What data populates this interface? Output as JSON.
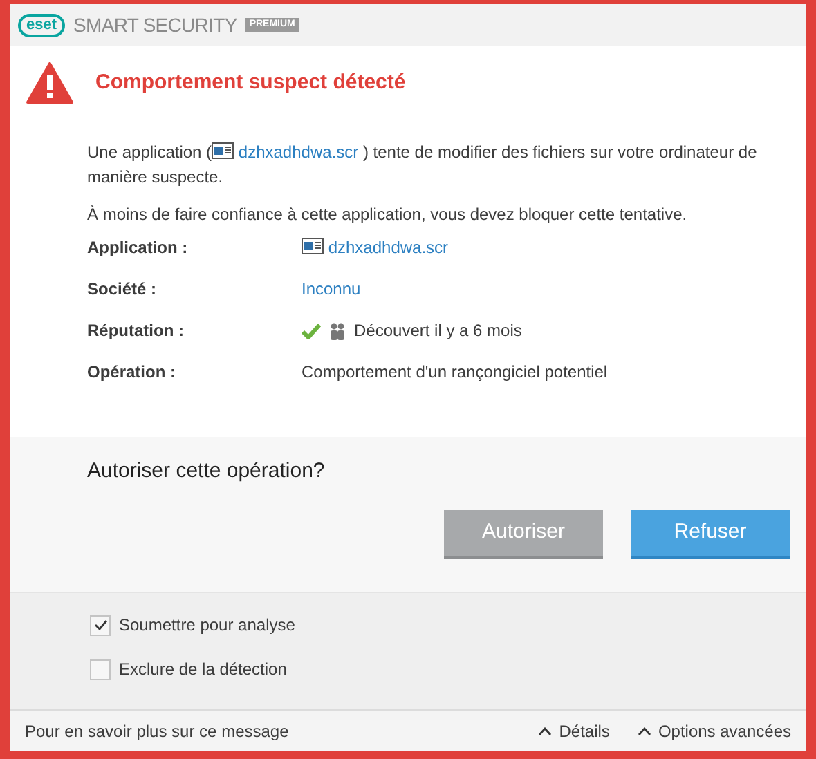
{
  "header": {
    "logo": "eset",
    "product": "SMART SECURITY",
    "edition": "PREMIUM"
  },
  "alert": {
    "title": "Comportement suspect détecté"
  },
  "message": {
    "before": "Une application (",
    "link": "dzhxadhdwa.scr",
    "after": " ) tente de modifier des fichiers sur votre ordinateur de manière suspecte."
  },
  "advice": "À moins de faire confiance à cette application, vous devez bloquer cette tentative.",
  "details": [
    {
      "label": "Application :",
      "kind": "file",
      "value": "dzhxadhdwa.scr"
    },
    {
      "label": "Société :",
      "kind": "link",
      "value": "Inconnu"
    },
    {
      "label": "Réputation :",
      "kind": "reputation",
      "value": "Découvert il y a 6 mois"
    },
    {
      "label": "Opération :",
      "kind": "text",
      "value": "Comportement d'un rançongiciel potentiel"
    }
  ],
  "question": "Autoriser cette opération?",
  "buttons": [
    {
      "label": "Autoriser",
      "kind": "secondary"
    },
    {
      "label": "Refuser",
      "kind": "primary"
    }
  ],
  "options": [
    {
      "label": "Soumettre pour analyse",
      "checked": true
    },
    {
      "label": "Exclure de la détection",
      "checked": false
    }
  ],
  "footer": {
    "learn_more": "Pour en savoir plus sur ce message",
    "toggles": [
      "Détails",
      "Options avancées"
    ]
  }
}
